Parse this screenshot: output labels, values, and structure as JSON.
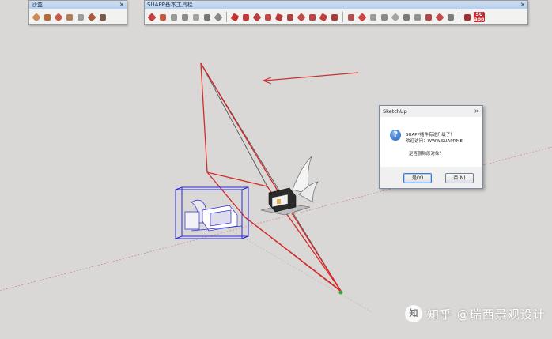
{
  "toolbars": {
    "sandbox": {
      "title": "沙盒",
      "close_glyph": "×",
      "tools": [
        "sandbox-contours-icon",
        "sandbox-scratch-icon",
        "smoove-icon",
        "stamp-icon",
        "drape-icon",
        "add-detail-icon",
        "flip-edge-icon"
      ]
    },
    "suapp": {
      "title": "SUAPP基本工具栏",
      "close_glyph": "×",
      "logo_text_top": "SU",
      "logo_text_bottom": "app"
    }
  },
  "dialog": {
    "title": "SketchUp",
    "close_glyph": "×",
    "icon_glyph": "?",
    "line1": "SUAPP插件有途升级了！",
    "line2": "欢迎访问：WWW.SUAPP.ME",
    "line3": "是否删除原对象？",
    "yes_label": "是(Y)",
    "no_label": "否(N)"
  },
  "watermark": {
    "logo_glyph": "知",
    "text": "知乎 @瑞西景观设计"
  },
  "colors": {
    "background": "#d9d8d6",
    "path_red": "#d62a2a",
    "section_blue": "#2a2ad8",
    "arrow_red": "#c83232"
  }
}
